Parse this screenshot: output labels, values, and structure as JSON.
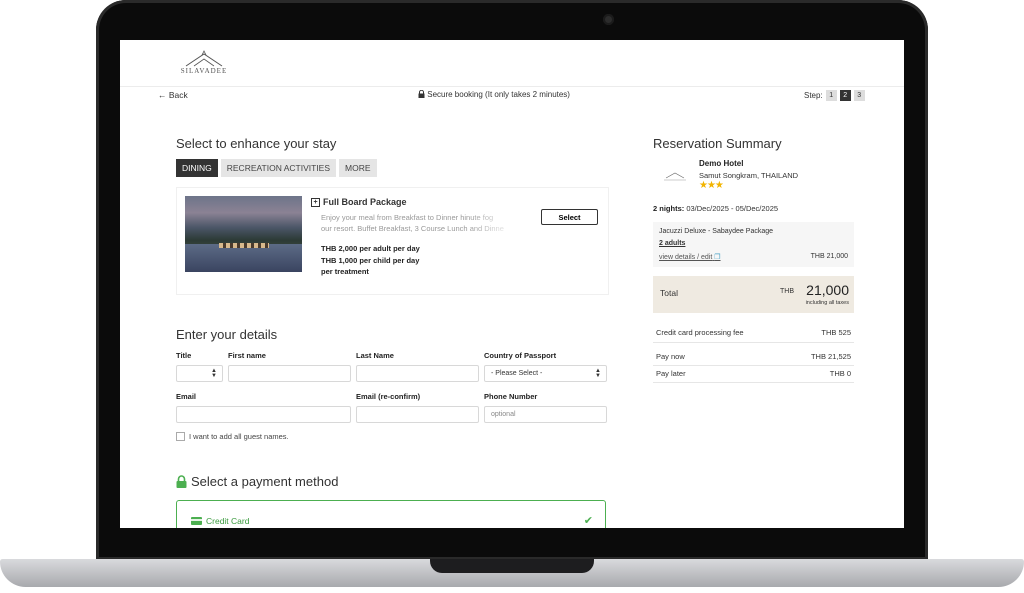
{
  "brand": {
    "logo_text": "SILAVADEE"
  },
  "header": {
    "back_label": "Back",
    "secure_text": "Secure booking (It only takes 2 minutes)",
    "step_label": "Step:",
    "steps": [
      "1",
      "2",
      "3"
    ],
    "active_step": "2"
  },
  "enhance": {
    "title": "Select to enhance your stay",
    "tabs": [
      "DINING",
      "RECREATION ACTIVITIES",
      "MORE"
    ],
    "active_tab": "DINING",
    "package": {
      "name": "Full Board Package",
      "description_lines": [
        "Enjoy your meal from Breakfast to Dinner hinute fog",
        "our resort. Buffet Breakfast, 3 Course Lunch and Dinne"
      ],
      "price_lines": [
        "THB 2,000 per adult per day",
        "THB 1,000 per child per day",
        "per treatment"
      ],
      "select_label": "Select"
    }
  },
  "details": {
    "title": "Enter your details",
    "labels": {
      "title": "Title",
      "first_name": "First name",
      "last_name": "Last Name",
      "country": "Country of Passport",
      "email": "Email",
      "email_confirm": "Email (re-confirm)",
      "phone": "Phone Number"
    },
    "country_placeholder": "- Please Select -",
    "phone_placeholder": "optional",
    "guest_names_label": "I want to add all guest names."
  },
  "payment": {
    "title": "Select a payment method",
    "method": "Credit Card"
  },
  "summary": {
    "title": "Reservation Summary",
    "hotel_name": "Demo Hotel",
    "location": "Samut Songkram, THAILAND",
    "stars": "★★★",
    "nights_label": "2 nights:",
    "dates": "03/Dec/2025 - 05/Dec/2025",
    "room_name": "Jacuzzi Deluxe - Sabaydee Package",
    "adults": "2 adults",
    "view_details": "view details / edit",
    "room_price": "THB 21,000",
    "total_label": "Total",
    "total_currency": "THB",
    "total_amount": "21,000",
    "total_note": "including all taxes",
    "cc_fee_label": "Credit card processing fee",
    "cc_fee": "THB 525",
    "pay_now_label": "Pay now",
    "pay_now": "THB 21,525",
    "pay_later_label": "Pay later",
    "pay_later": "THB 0"
  },
  "colors": {
    "accent_green": "#4caf50",
    "total_bg": "#efeae1",
    "active_tab": "#333333"
  }
}
